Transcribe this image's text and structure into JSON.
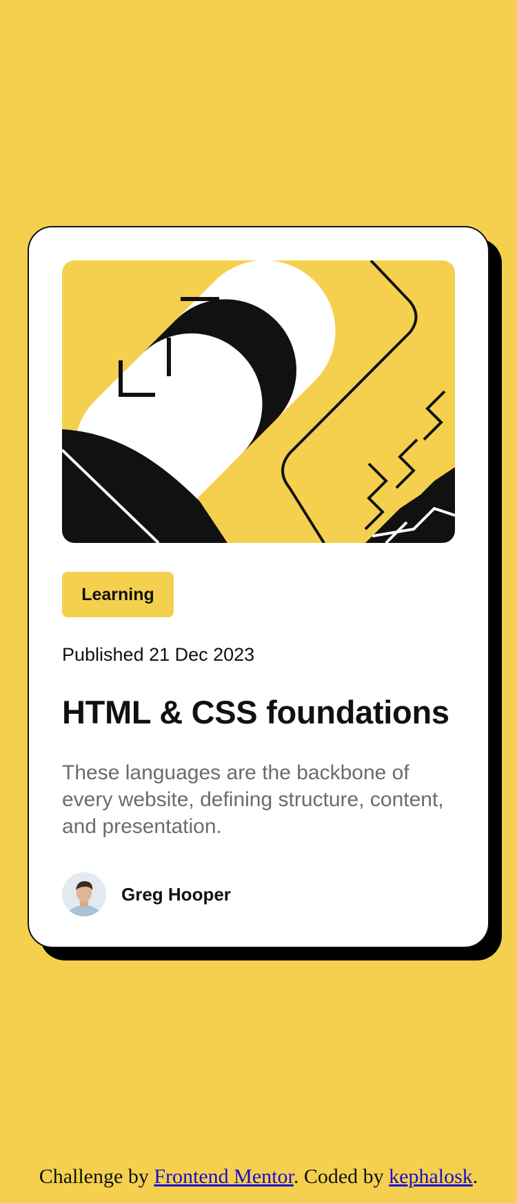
{
  "colors": {
    "page_background": "#f4d04e",
    "card_background": "#ffffff",
    "ink": "#111111",
    "muted_text": "#6b6b6b",
    "link": "#1a0dcc"
  },
  "card": {
    "tag": "Learning",
    "published": "Published 21 Dec 2023",
    "title": "HTML & CSS foundations",
    "description": "These languages are the backbone of every website, defining structure, content, and presentation.",
    "author": {
      "name": "Greg Hooper"
    }
  },
  "footer": {
    "prefix": "Challenge by ",
    "frontend_mentor_link": "Frontend Mentor",
    "middle": ". Coded by ",
    "author_link": "kephalosk",
    "suffix": "."
  },
  "icons": {
    "hero": "abstract-illustration",
    "avatar": "person-avatar"
  }
}
